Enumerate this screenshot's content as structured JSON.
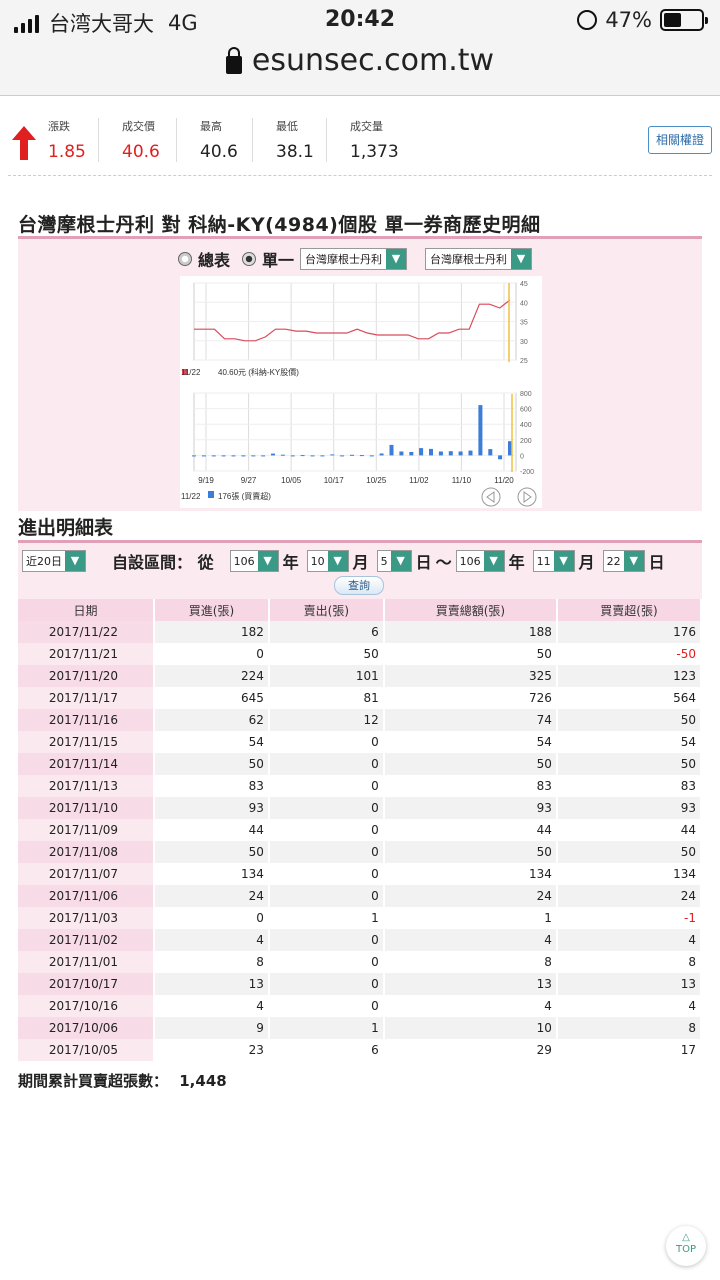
{
  "status": {
    "carrier": "台湾大哥大",
    "network": "4G",
    "time": "20:42",
    "battery": "47%",
    "battery_level": 0.47
  },
  "browser": {
    "url": "esunsec.com.tw"
  },
  "quote": {
    "change_label": "漲跌",
    "change": "1.85",
    "price_label": "成交價",
    "price": "40.6",
    "high_label": "最高",
    "high": "40.6",
    "low_label": "最低",
    "low": "38.1",
    "volume_label": "成交量",
    "volume": "1,373",
    "related_button": "相關權證"
  },
  "title": "台灣摩根士丹利 對 科納-KY(4984)個股 單一券商歷史明細",
  "controls": {
    "summary_label": "總表",
    "single_label": "單一",
    "broker1": "台灣摩根士丹利",
    "broker2": "台灣摩根士丹利"
  },
  "chart_data": [
    {
      "type": "line",
      "x_ticks": [
        "9/19",
        "9/27",
        "10/05",
        "10/17",
        "10/25",
        "11/02",
        "11/10",
        "11/20"
      ],
      "ylim": [
        25,
        45
      ],
      "y_ticks": [
        "45",
        "40",
        "35",
        "30",
        "25"
      ],
      "values": [
        33,
        33,
        33,
        30.5,
        30.5,
        30,
        30,
        31,
        33,
        33,
        32.5,
        32.5,
        32,
        32,
        32,
        32,
        33,
        32,
        31.5,
        31.5,
        31.5,
        31.5,
        30.5,
        30.5,
        32,
        32,
        33,
        33,
        39.5,
        39.5,
        38.5,
        40.6
      ],
      "legend_date": "11/22",
      "legend": "40.60元 (科納-KY股價)",
      "color": "#d94a5a"
    },
    {
      "type": "bar",
      "x_ticks": [
        "9/19",
        "9/27",
        "10/05",
        "10/17",
        "10/25",
        "11/02",
        "11/10",
        "11/20"
      ],
      "ylim": [
        -200,
        800
      ],
      "y_ticks": [
        "800",
        "600",
        "400",
        "200",
        "0",
        "-200"
      ],
      "values": [
        0,
        0,
        0,
        0,
        0,
        0,
        0,
        0,
        23,
        9,
        0,
        4,
        0,
        0,
        13,
        0,
        8,
        4,
        0,
        24,
        134,
        50,
        44,
        93,
        83,
        50,
        54,
        50,
        62,
        645,
        81,
        -50,
        182
      ],
      "legend_date": "11/22",
      "legend": "176張 (買賣超)",
      "color": "#3b7dd8"
    }
  ],
  "detail": {
    "heading": "進出明細表",
    "period_select": "近20日",
    "custom_range_label": "自設區間： 從",
    "from_year": "106",
    "year_label": "年",
    "from_month": "10",
    "month_label": "月",
    "from_day": "5",
    "day_label": "日",
    "tilde": "～",
    "to_year": "106",
    "to_month": "11",
    "to_day": "22",
    "query_button": "查詢",
    "columns": [
      "日期",
      "買進(張)",
      "賣出(張)",
      "買賣總額(張)",
      "買賣超(張)"
    ],
    "rows": [
      [
        "2017/11/22",
        "182",
        "6",
        "188",
        "176"
      ],
      [
        "2017/11/21",
        "0",
        "50",
        "50",
        "-50"
      ],
      [
        "2017/11/20",
        "224",
        "101",
        "325",
        "123"
      ],
      [
        "2017/11/17",
        "645",
        "81",
        "726",
        "564"
      ],
      [
        "2017/11/16",
        "62",
        "12",
        "74",
        "50"
      ],
      [
        "2017/11/15",
        "54",
        "0",
        "54",
        "54"
      ],
      [
        "2017/11/14",
        "50",
        "0",
        "50",
        "50"
      ],
      [
        "2017/11/13",
        "83",
        "0",
        "83",
        "83"
      ],
      [
        "2017/11/10",
        "93",
        "0",
        "93",
        "93"
      ],
      [
        "2017/11/09",
        "44",
        "0",
        "44",
        "44"
      ],
      [
        "2017/11/08",
        "50",
        "0",
        "50",
        "50"
      ],
      [
        "2017/11/07",
        "134",
        "0",
        "134",
        "134"
      ],
      [
        "2017/11/06",
        "24",
        "0",
        "24",
        "24"
      ],
      [
        "2017/11/03",
        "0",
        "1",
        "1",
        "-1"
      ],
      [
        "2017/11/02",
        "4",
        "0",
        "4",
        "4"
      ],
      [
        "2017/11/01",
        "8",
        "0",
        "8",
        "8"
      ],
      [
        "2017/10/17",
        "13",
        "0",
        "13",
        "13"
      ],
      [
        "2017/10/16",
        "4",
        "0",
        "4",
        "4"
      ],
      [
        "2017/10/06",
        "9",
        "1",
        "10",
        "8"
      ],
      [
        "2017/10/05",
        "23",
        "6",
        "29",
        "17"
      ]
    ],
    "total_label": "期間累計買賣超張數：",
    "total_value": "1,448"
  },
  "top_button": "TOP",
  "colors": {
    "accent_pink": "#f7d7e3",
    "select_green": "#3a9a86",
    "negative_red": "#e02020"
  }
}
